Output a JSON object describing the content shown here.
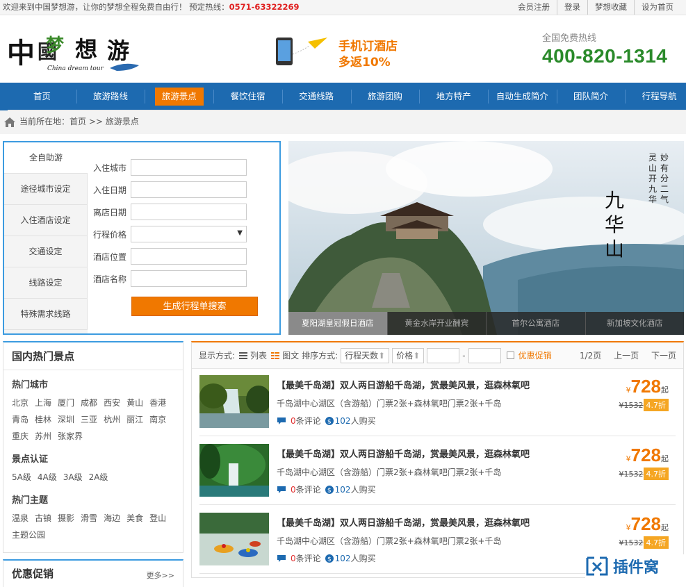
{
  "topbar": {
    "welcome": "欢迎来到中国梦想游，让你的梦想全程免费自由行！ 预定热线：",
    "phone": "0571-63322269",
    "links": [
      "会员注册",
      "登录",
      "梦想收藏",
      "设为首页"
    ]
  },
  "header": {
    "logo_text": "中国梦想游",
    "logo_sub": "China dream tour",
    "promo_line1": "手机订酒店",
    "promo_line2": "多返10%",
    "hotline_label": "全国免费热线",
    "hotline_number": "400-820-1314"
  },
  "nav": {
    "items": [
      "首页",
      "旅游路线",
      "旅游景点",
      "餐饮住宿",
      "交通线路",
      "旅游团购",
      "地方特产",
      "自动生成简介",
      "团队简介",
      "行程导航"
    ],
    "active_index": 2
  },
  "breadcrumb": {
    "label": "当前所在地：",
    "home": "首页",
    "sep": " >> ",
    "current": "旅游景点"
  },
  "search": {
    "tabs": [
      "全自助游",
      "途径城市设定",
      "入住酒店设定",
      "交通设定",
      "线路设定",
      "特殊需求线路"
    ],
    "active_tab": 0,
    "fields": [
      "入住城市",
      "入住日期",
      "离店日期",
      "行程价格",
      "酒店位置",
      "酒店名称"
    ],
    "select_arrow": "▼",
    "submit": "生成行程单搜索"
  },
  "banner": {
    "calligraphy_main": "九华山",
    "calligraphy_side": "妙有分二气 灵山开九华",
    "captions": [
      "夏阳湖皇冠假日酒店",
      "黄金水岸开业酬宾",
      "首尔公寓酒店",
      "新加坡文化酒店"
    ],
    "active_caption": 0
  },
  "hot": {
    "title": "国内热门景点",
    "city_heading": "热门城市",
    "cities": [
      "北京",
      "上海",
      "厦门",
      "成都",
      "西安",
      "黄山",
      "香港",
      "青岛",
      "桂林",
      "深圳",
      "三亚",
      "杭州",
      "丽江",
      "南京",
      "重庆",
      "苏州",
      "张家界"
    ],
    "cert_heading": "景点认证",
    "certs": [
      "5A级",
      "4A级",
      "3A级",
      "2A级"
    ],
    "theme_heading": "热门主题",
    "themes": [
      "温泉",
      "古镇",
      "摄影",
      "滑雪",
      "海边",
      "美食",
      "登山",
      "主题公园"
    ]
  },
  "promo_box": {
    "title": "优惠促销",
    "more": "更多>>"
  },
  "listbar": {
    "display_label": "显示方式:",
    "list_label": "列表",
    "pic_label": "图文",
    "sort_label": "排序方式:",
    "sort_days": "行程天数",
    "sort_price": "价格",
    "dash": "-",
    "promo_check": "优惠促销",
    "page": "1/2页",
    "prev": "上一页",
    "next": "下一页"
  },
  "items": [
    {
      "title": "【最美千岛湖】双人两日游船千岛湖，赏最美风景，逛森林氧吧",
      "sub": "千岛湖中心湖区（含游船）门票2张+森林氧吧门票2张+千岛",
      "comments": "0",
      "comments_label": "条评论",
      "bought": "102",
      "bought_label": "人购买",
      "yen": "¥",
      "price": "728",
      "qi": "起",
      "old": "¥1532",
      "disc": "4.7折"
    },
    {
      "title": "【最美千岛湖】双人两日游船千岛湖，赏最美风景，逛森林氧吧",
      "sub": "千岛湖中心湖区（含游船）门票2张+森林氧吧门票2张+千岛",
      "comments": "0",
      "comments_label": "条评论",
      "bought": "102",
      "bought_label": "人购买",
      "yen": "¥",
      "price": "728",
      "qi": "起",
      "old": "¥1532",
      "disc": "4.7折"
    },
    {
      "title": "【最美千岛湖】双人两日游船千岛湖，赏最美风景，逛森林氧吧",
      "sub": "千岛湖中心湖区（含游船）门票2张+森林氧吧门票2张+千岛",
      "comments": "0",
      "comments_label": "条评论",
      "bought": "102",
      "bought_label": "人购买",
      "yen": "¥",
      "price": "728",
      "qi": "起",
      "old": "¥1532",
      "disc": "4.7折"
    }
  ],
  "watermark": "插件窝",
  "colors": {
    "nav": "#1d6ab0",
    "accent": "#f07800",
    "hotline": "#2a8a2a"
  }
}
